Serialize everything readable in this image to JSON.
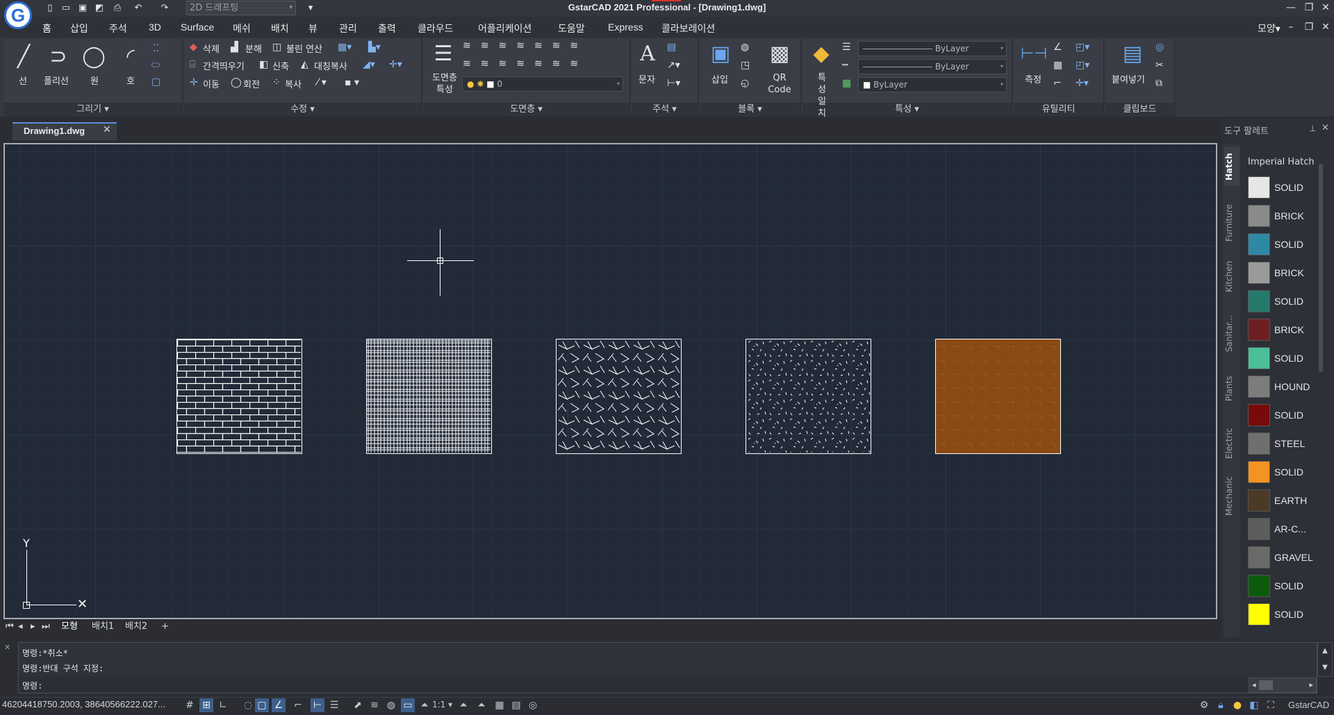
{
  "window": {
    "title": "GstarCAD 2021 Professional - [Drawing1.dwg]",
    "workspace": "2D 드래프팅",
    "right_menu": "모양"
  },
  "quick_access": [
    "new-icon",
    "open-icon",
    "save-icon",
    "saveas-icon",
    "print-icon",
    "undo-icon",
    "redo-icon"
  ],
  "menu": [
    "홈",
    "삽입",
    "주석",
    "3D",
    "Surface",
    "메쉬",
    "배치",
    "뷰",
    "관리",
    "출력",
    "클라우드",
    "어플리케이션",
    "도움말",
    "Express",
    "콜라보레이션"
  ],
  "ribbon": {
    "draw": {
      "title": "그리기",
      "tools": [
        "선",
        "폴리선",
        "원",
        "호"
      ]
    },
    "modify": {
      "title": "수정",
      "row1": [
        "삭제",
        "분해",
        "불린 연산"
      ],
      "row2": [
        "간격띄우기",
        "신축",
        "대칭복사"
      ],
      "row3": [
        "이동",
        "회전",
        "복사"
      ]
    },
    "layers": {
      "title": "도면층",
      "tool": "도면층 특성",
      "current_layer": "0"
    },
    "annotation": {
      "title": "주석",
      "tool": "문자"
    },
    "block": {
      "title": "블록",
      "insert": "삽입",
      "qr": "QR Code"
    },
    "properties": {
      "title": "특성",
      "match": "특성 일치",
      "color": "ByLayer",
      "linetype": "ByLayer",
      "lineweight": "ByLayer"
    },
    "utilities": {
      "title": "유틸리티",
      "measure": "측정"
    },
    "clipboard": {
      "title": "클립보드",
      "paste": "붙여넣기"
    }
  },
  "document": {
    "tab": "Drawing1.dwg"
  },
  "layout_tabs": [
    "모형",
    "배치1",
    "배치2",
    "+"
  ],
  "palette": {
    "title": "도구 팔레트",
    "vertical_tabs": [
      "Hatch",
      "Furniture",
      "Kitchen",
      "Sanitar...",
      "Plants",
      "Electric",
      "Mechanic"
    ],
    "group": "Imperial Hatch",
    "items": [
      {
        "label": "SOLID",
        "color": "#e6e6e6"
      },
      {
        "label": "BRICK",
        "color": "#8a8a8a"
      },
      {
        "label": "SOLID",
        "color": "#2f88a4"
      },
      {
        "label": "BRICK",
        "color": "#9a9a9a"
      },
      {
        "label": "SOLID",
        "color": "#257a6d"
      },
      {
        "label": "BRICK",
        "color": "#6e1f24"
      },
      {
        "label": "SOLID",
        "color": "#4bbf9a"
      },
      {
        "label": "HOUND",
        "color": "#7c7c7c"
      },
      {
        "label": "SOLID",
        "color": "#7a0a0a"
      },
      {
        "label": "STEEL",
        "color": "#6f6f6f"
      },
      {
        "label": "SOLID",
        "color": "#f59322"
      },
      {
        "label": "EARTH",
        "color": "#4b3a26"
      },
      {
        "label": "AR-C...",
        "color": "#5d5d5d"
      },
      {
        "label": "GRAVEL",
        "color": "#6a6a6a"
      },
      {
        "label": "SOLID",
        "color": "#0c5a0c"
      },
      {
        "label": "SOLID",
        "color": "#ffff00"
      }
    ]
  },
  "command": {
    "lines": [
      "명령:*취소*",
      "명령:반대 구석 지정:",
      "명령:"
    ]
  },
  "status": {
    "coords": "46204418750.2003, 38640566222.027...",
    "scale": "1:1",
    "app": "GstarCAD"
  },
  "canvas": {
    "hatches": [
      "brick",
      "crosshatch",
      "leaves",
      "gravel",
      "solid-brown"
    ],
    "hatch_fill_color": "#8b4a14"
  }
}
